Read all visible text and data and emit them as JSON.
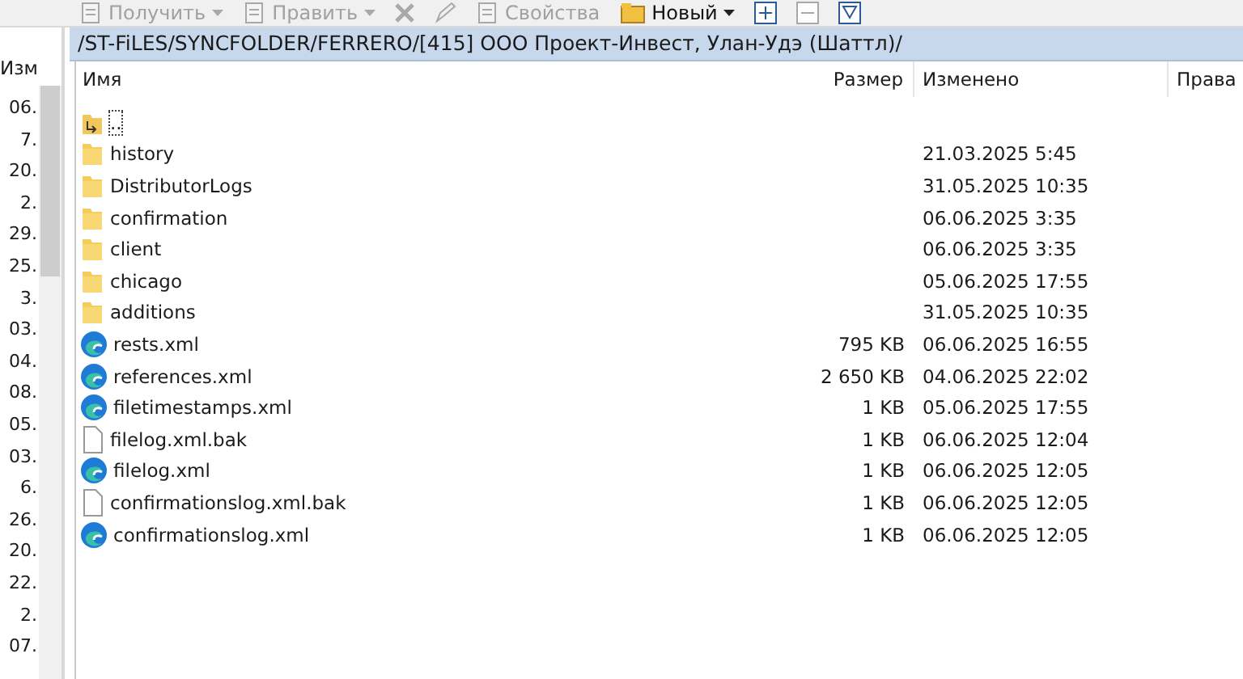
{
  "toolbar": [
    {
      "kind": "labeled",
      "label": "Получить",
      "dropdown": true,
      "disabled": true
    },
    {
      "kind": "labeled",
      "label": "Править",
      "dropdown": true,
      "disabled": true
    },
    {
      "kind": "delete",
      "disabled": true
    },
    {
      "kind": "edit",
      "disabled": true
    },
    {
      "kind": "labeled",
      "label": "Свойства",
      "dropdown": false,
      "disabled": true
    },
    {
      "kind": "labeled",
      "label": "Новый",
      "dropdown": true,
      "disabled": false
    },
    {
      "kind": "plus",
      "disabled": false
    },
    {
      "kind": "minus",
      "disabled": true
    },
    {
      "kind": "filter",
      "disabled": false
    }
  ],
  "left_panel": {
    "column_header": "Изм",
    "cells": [
      "06.",
      "7.",
      "20.",
      "2.",
      "29.",
      "25.",
      "3.",
      "03.",
      "04.",
      "08.",
      "05.",
      "03.",
      "6.",
      "26.",
      "20.",
      "22.",
      "2.",
      "07."
    ]
  },
  "path": "/ST-FiLES/SYNCFOLDER/FERRERO/[415] ООО Проект-Инвест, Улан-Удэ (Шаттл)/",
  "table": {
    "columns": [
      "Имя",
      "Размер",
      "Изменено",
      "Права"
    ],
    "rows": [
      {
        "kind": "parent",
        "name": "..",
        "size": "",
        "modified": ""
      },
      {
        "kind": "folder",
        "name": "history",
        "size": "",
        "modified": "21.03.2025 5:45"
      },
      {
        "kind": "folder",
        "name": "DistributorLogs",
        "size": "",
        "modified": "31.05.2025 10:35"
      },
      {
        "kind": "folder",
        "name": "confirmation",
        "size": "",
        "modified": "06.06.2025 3:35"
      },
      {
        "kind": "folder",
        "name": "client",
        "size": "",
        "modified": "06.06.2025 3:35"
      },
      {
        "kind": "folder",
        "name": "chicago",
        "size": "",
        "modified": "05.06.2025 17:55"
      },
      {
        "kind": "folder",
        "name": "additions",
        "size": "",
        "modified": "31.05.2025 10:35"
      },
      {
        "kind": "xml",
        "name": "rests.xml",
        "size": "795 KB",
        "modified": "06.06.2025 16:55"
      },
      {
        "kind": "xml",
        "name": "references.xml",
        "size": "2 650 KB",
        "modified": "04.06.2025 22:02"
      },
      {
        "kind": "xml",
        "name": "filetimestamps.xml",
        "size": "1 KB",
        "modified": "05.06.2025 17:55"
      },
      {
        "kind": "file",
        "name": "filelog.xml.bak",
        "size": "1 KB",
        "modified": "06.06.2025 12:04"
      },
      {
        "kind": "xml",
        "name": "filelog.xml",
        "size": "1 KB",
        "modified": "06.06.2025 12:05"
      },
      {
        "kind": "file",
        "name": "confirmationslog.xml.bak",
        "size": "1 KB",
        "modified": "06.06.2025 12:05"
      },
      {
        "kind": "xml",
        "name": "confirmationslog.xml",
        "size": "1 KB",
        "modified": "06.06.2025 12:05"
      }
    ]
  }
}
